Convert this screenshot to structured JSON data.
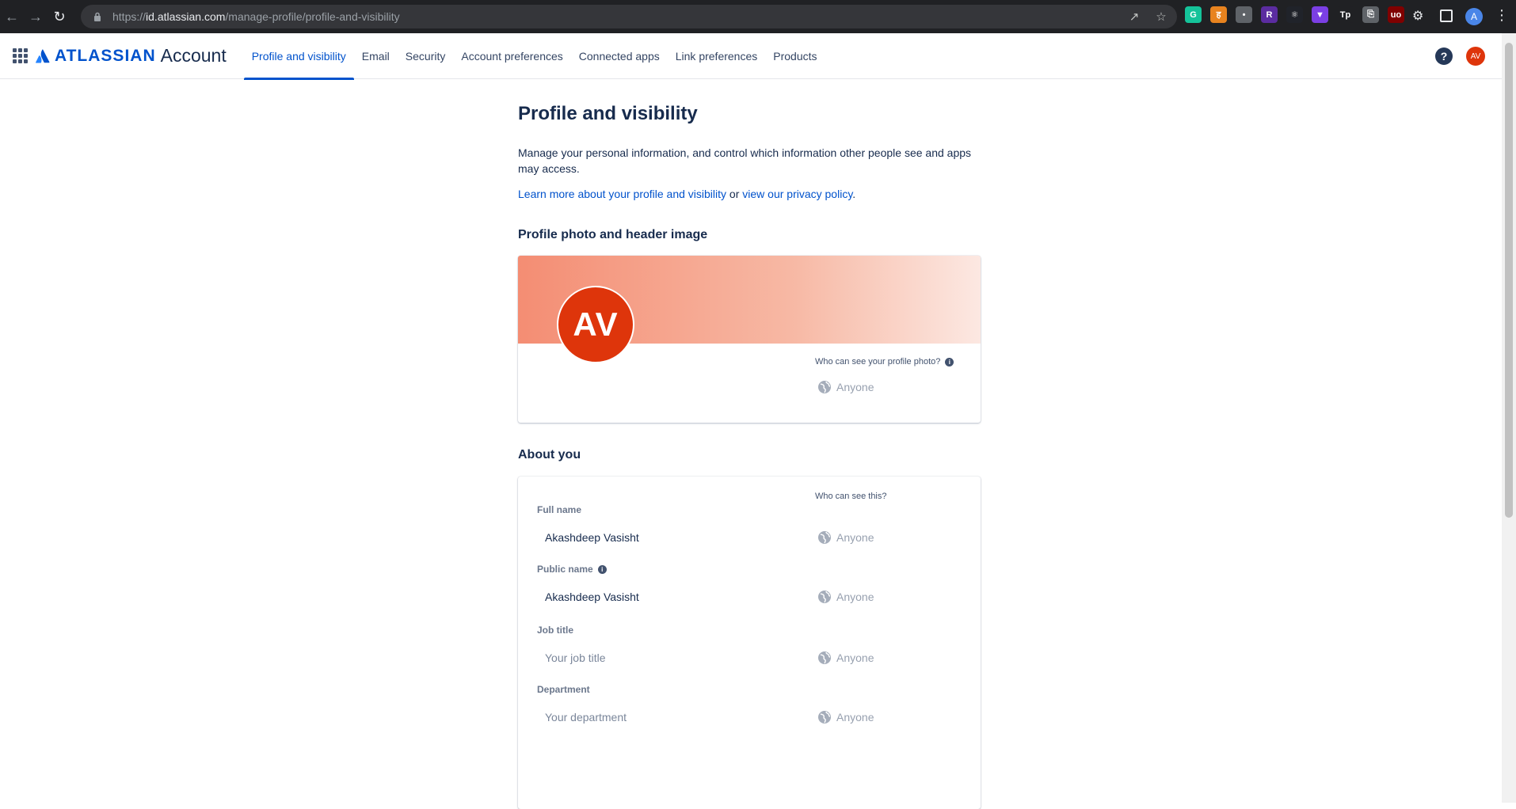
{
  "browser": {
    "url_scheme": "https://",
    "url_host": "id.atlassian.com",
    "url_path": "/manage-profile/profile-and-visibility",
    "profile_initial": "A",
    "extensions": [
      {
        "name": "grammarly-extension-icon",
        "glyph": "G",
        "color": "#15C39A"
      },
      {
        "name": "orange-extension-icon",
        "glyph": "ह",
        "color": "#E8831F"
      },
      {
        "name": "gray-extension-icon",
        "glyph": "•",
        "color": "#5f6368"
      },
      {
        "name": "purple-r-extension-icon",
        "glyph": "R",
        "color": "#5B2CA0"
      },
      {
        "name": "react-devtools-icon",
        "glyph": "⚛",
        "color": "#20232a"
      },
      {
        "name": "purple-shield-extension-icon",
        "glyph": "▼",
        "color": "#7B3FE4"
      },
      {
        "name": "tp-extension-icon",
        "glyph": "Tp",
        "color": "#202124"
      },
      {
        "name": "clipboard-extension-icon",
        "glyph": "⎘",
        "color": "#5f6368"
      },
      {
        "name": "ublock-origin-icon",
        "glyph": "uo",
        "color": "#800000"
      }
    ]
  },
  "header": {
    "brand": "ATLASSIAN",
    "product": "Account",
    "tabs": [
      {
        "label": "Profile and visibility",
        "active": true
      },
      {
        "label": "Email",
        "active": false
      },
      {
        "label": "Security",
        "active": false
      },
      {
        "label": "Account preferences",
        "active": false
      },
      {
        "label": "Connected apps",
        "active": false
      },
      {
        "label": "Link preferences",
        "active": false
      },
      {
        "label": "Products",
        "active": false
      }
    ],
    "help_glyph": "?",
    "avatar_initials": "AV"
  },
  "page": {
    "title": "Profile and visibility",
    "intro": "Manage your personal information, and control which information other people see and apps may access.",
    "learn_link": "Learn more about your profile and visibility",
    "learn_or": " or ",
    "privacy_link": "view our privacy policy",
    "learn_end": "."
  },
  "photo_section": {
    "title": "Profile photo and header image",
    "avatar_initials": "AV",
    "visibility_question": "Who can see your profile photo?",
    "visibility_value": "Anyone"
  },
  "about": {
    "title": "About you",
    "who_can_see": "Who can see this?",
    "fields": [
      {
        "label": "Full name",
        "value": "Akashdeep Vasisht",
        "placeholder": false,
        "visibility": "Anyone",
        "info": false
      },
      {
        "label": "Public name",
        "value": "Akashdeep Vasisht",
        "placeholder": false,
        "visibility": "Anyone",
        "info": true
      },
      {
        "label": "Job title",
        "value": "Your job title",
        "placeholder": true,
        "visibility": "Anyone",
        "info": false
      },
      {
        "label": "Department",
        "value": "Your department",
        "placeholder": true,
        "visibility": "Anyone",
        "info": false
      }
    ]
  },
  "colors": {
    "brand_blue": "#0052CC",
    "avatar_red": "#DE350B",
    "text_dark": "#172B4D"
  }
}
